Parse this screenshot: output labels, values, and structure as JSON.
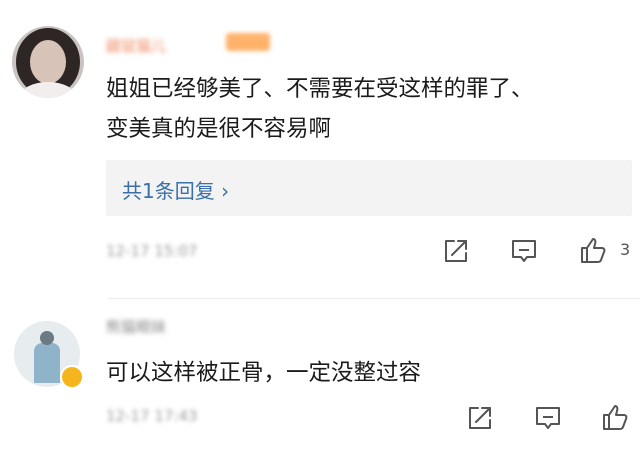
{
  "comments": [
    {
      "username": "鼹鼠猫儿",
      "text_lines": [
        "姐姐已经够美了、不需要在受这样的罪了、",
        "变美真的是很不容易啊"
      ],
      "reply_link": "共1条回复 ›",
      "time": "12-17 15:07",
      "likes": "3",
      "icons": [
        "share-icon",
        "comment-icon",
        "thumbs-up-icon"
      ]
    },
    {
      "username": "熊猫眼妹",
      "text": "可以这样被正骨，一定没整过容",
      "time": "12-17 17:43",
      "icons": [
        "share-icon",
        "comment-icon",
        "thumbs-up-icon"
      ]
    }
  ],
  "colors": {
    "link": "#3a6fa8",
    "icon": "#555555",
    "reply_box": "#f3f3f3"
  }
}
